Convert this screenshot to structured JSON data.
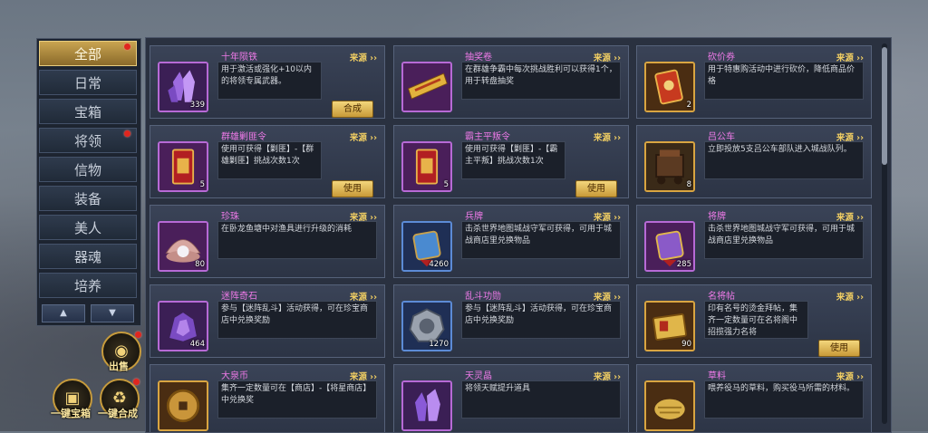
{
  "categories": [
    {
      "label": "全部",
      "active": true,
      "dot": true
    },
    {
      "label": "日常",
      "active": false,
      "dot": false
    },
    {
      "label": "宝箱",
      "active": false,
      "dot": false
    },
    {
      "label": "将领",
      "active": false,
      "dot": true
    },
    {
      "label": "信物",
      "active": false,
      "dot": false
    },
    {
      "label": "装备",
      "active": false,
      "dot": false
    },
    {
      "label": "美人",
      "active": false,
      "dot": false
    },
    {
      "label": "器魂",
      "active": false,
      "dot": false
    },
    {
      "label": "培养",
      "active": false,
      "dot": false
    }
  ],
  "nav": {
    "up_icon": "▲",
    "down_icon": "▼"
  },
  "bottom_buttons": {
    "sell": {
      "label": "出售",
      "icon": "coins-icon"
    },
    "open_box": {
      "label": "一键宝箱",
      "icon": "chest-icon"
    },
    "combine": {
      "label": "一键合成",
      "icon": "combine-icon"
    }
  },
  "source_label": "来源 ››",
  "items": [
    {
      "name": "十年陨铁",
      "qty": "339",
      "desc": "用于激活或强化+10以内的将领专属武器。",
      "action": "合成",
      "icon": "crystal-icon",
      "frame": "purple"
    },
    {
      "name": "抽奖卷",
      "qty": "",
      "desc": "在群雄争霸中每次挑战胜利可以获得1个，用于转盘抽奖",
      "action": "",
      "icon": "lottery-ticket-icon",
      "frame": "purple"
    },
    {
      "name": "砍价券",
      "qty": "2",
      "desc": "用于特惠购活动中进行砍价，降低商品价格",
      "action": "",
      "icon": "coupon-icon",
      "frame": "gold"
    },
    {
      "name": "群雄剿匪令",
      "qty": "5",
      "desc": "使用可获得【剿匪】-【群雄剿匪】挑战次数1次",
      "action": "使用",
      "icon": "token-icon",
      "frame": "purple"
    },
    {
      "name": "霸主平叛令",
      "qty": "5",
      "desc": "使用可获得【剿匪】-【霸主平叛】挑战次数1次",
      "action": "使用",
      "icon": "token-icon",
      "frame": "purple"
    },
    {
      "name": "吕公车",
      "qty": "8",
      "desc": "立即投放5支吕公车部队进入城战队列。",
      "action": "",
      "icon": "siege-cart-icon",
      "frame": "gold"
    },
    {
      "name": "珍珠",
      "qty": "80",
      "desc": "在卧龙鱼塘中对渔具进行升级的消耗",
      "action": "",
      "icon": "pearl-icon",
      "frame": "purple"
    },
    {
      "name": "兵牌",
      "qty": "4260",
      "desc": "击杀世界地图城战守军可获得，可用于城战商店里兑换物品",
      "action": "",
      "icon": "soldier-badge-icon",
      "frame": "blue"
    },
    {
      "name": "将牌",
      "qty": "285",
      "desc": "击杀世界地图城战守军可获得，可用于城战商店里兑换物品",
      "action": "",
      "icon": "general-badge-icon",
      "frame": "purple"
    },
    {
      "name": "迷阵奇石",
      "qty": "464",
      "desc": "参与【迷阵乱斗】活动获得，可在珍宝商店中兑换奖励",
      "action": "",
      "icon": "stone-icon",
      "frame": "purple"
    },
    {
      "name": "乱斗功勋",
      "qty": "1270",
      "desc": "参与【迷阵乱斗】活动获得，可在珍宝商店中兑换奖励",
      "action": "",
      "icon": "medal-icon",
      "frame": "blue"
    },
    {
      "name": "名将帖",
      "qty": "90",
      "desc": "印有名号的烫金拜帖，集齐一定数量可在名将阁中招揽强力名将",
      "action": "使用",
      "icon": "invitation-icon",
      "frame": "gold"
    },
    {
      "name": "大泉币",
      "qty": "",
      "desc": "集齐一定数量可在【商店】-【将星商店】中兑换奖",
      "action": "",
      "icon": "coin-icon",
      "frame": "gold"
    },
    {
      "name": "天灵晶",
      "qty": "",
      "desc": "将领天赋提升道具",
      "action": "",
      "icon": "spirit-crystal-icon",
      "frame": "purple"
    },
    {
      "name": "草料",
      "qty": "",
      "desc": "喂养役马的草料，购买役马所需的材料。",
      "action": "",
      "icon": "hay-icon",
      "frame": "gold"
    }
  ]
}
